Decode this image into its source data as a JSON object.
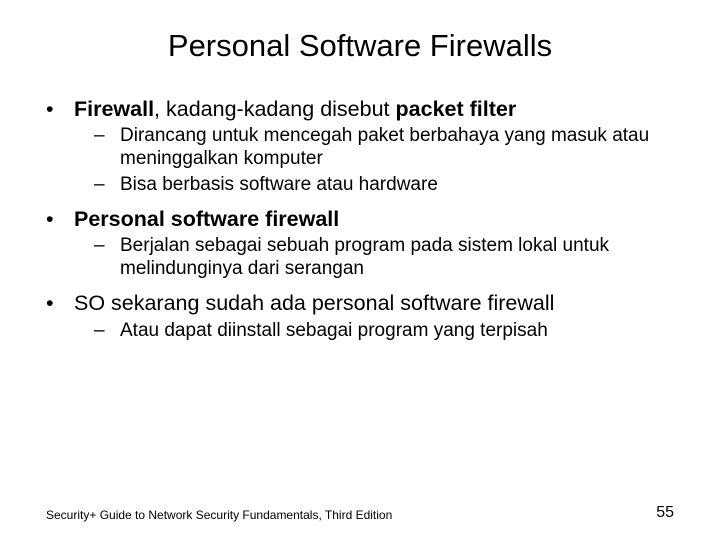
{
  "title": "Personal Software Firewalls",
  "bullets": {
    "b1_bold1": "Firewall",
    "b1_mid": ", kadang-kadang disebut ",
    "b1_bold2": "packet filter",
    "b1_s1": "Dirancang untuk mencegah paket berbahaya yang masuk atau meninggalkan komputer",
    "b1_s2": "Bisa berbasis software atau hardware",
    "b2_bold": "Personal software firewall",
    "b2_s1": "Berjalan sebagai sebuah program pada sistem lokal untuk melindunginya dari serangan",
    "b3": "SO sekarang sudah ada personal software firewall",
    "b3_s1": "Atau dapat diinstall sebagai program yang terpisah"
  },
  "footer": {
    "book": "Security+ Guide to Network Security Fundamentals, Third Edition",
    "page": "55"
  }
}
